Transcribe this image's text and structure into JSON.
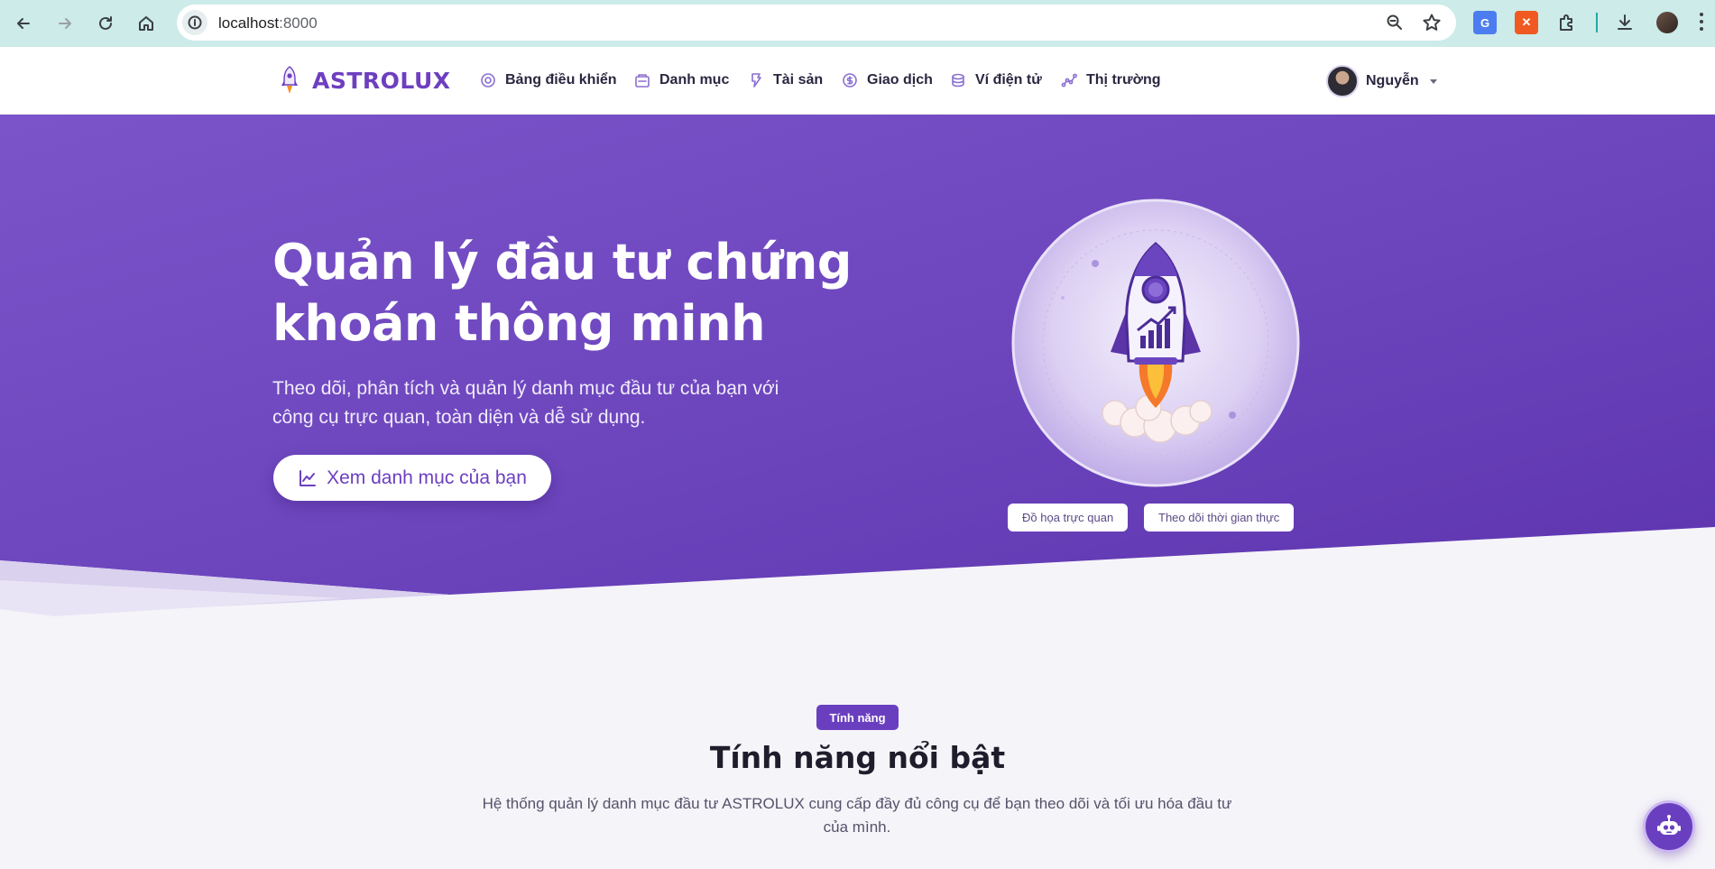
{
  "browser": {
    "url_host": "localhost",
    "url_port": ":8000"
  },
  "brand": {
    "name": "ASTROLUX"
  },
  "nav": {
    "items": [
      {
        "label": "Bảng điều khiển",
        "icon": "dashboard-icon"
      },
      {
        "label": "Danh mục",
        "icon": "portfolio-icon"
      },
      {
        "label": "Tài sản",
        "icon": "assets-icon"
      },
      {
        "label": "Giao dịch",
        "icon": "transaction-icon"
      },
      {
        "label": "Ví điện tử",
        "icon": "wallet-icon"
      },
      {
        "label": "Thị trường",
        "icon": "market-icon"
      }
    ],
    "user_name": "Nguyễn"
  },
  "hero": {
    "title_line1": "Quản lý đầu tư chứng",
    "title_line2": "khoán thông minh",
    "subtitle_line1": "Theo dõi, phân tích và quản lý danh mục đầu tư của bạn với",
    "subtitle_line2": "công cụ trực quan, toàn diện và dễ sử dụng.",
    "cta_label": "Xem danh mục của bạn",
    "tags": [
      "Đồ họa trực quan",
      "Theo dõi thời gian thực"
    ]
  },
  "features": {
    "badge": "Tính năng",
    "title": "Tính năng nổi bật",
    "description": "Hệ thống quản lý danh mục đầu tư ASTROLUX cung cấp đầy đủ công cụ để bạn theo dõi và tối ưu hóa đầu tư của mình."
  },
  "colors": {
    "brand": "#6d3fc0",
    "hero_start": "#7a52c8",
    "hero_end": "#5e35b1",
    "page_bg": "#f5f4f9"
  }
}
